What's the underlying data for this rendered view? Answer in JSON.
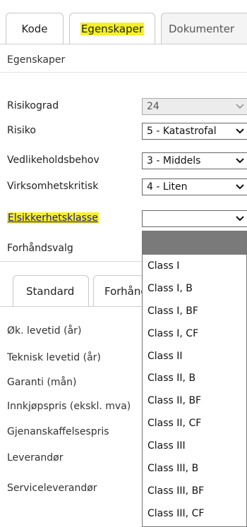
{
  "tabs": [
    {
      "label": "Kode"
    },
    {
      "label": "Egenskaper",
      "highlighted": true,
      "active": true
    },
    {
      "label": "Dokumenter"
    }
  ],
  "section_title": "Egenskaper",
  "fields": [
    {
      "label": "Risikograd",
      "value": "24",
      "disabled": true
    },
    {
      "label": "Risiko",
      "value": "5 - Katastrofal"
    },
    {
      "label": "Vedlikeholdsbehov",
      "value": "3 - Middels"
    },
    {
      "label": "Virksomhetskritisk",
      "value": "4 - Liten"
    },
    {
      "label": "Elsikkerhetsklasse",
      "value": "",
      "link": true,
      "highlighted": true
    }
  ],
  "preset_label": "Forhåndsvalg",
  "lower_tabs": [
    {
      "label": "Standard"
    },
    {
      "label": "Forhåndsvalg"
    }
  ],
  "lower_fields": [
    {
      "label": "Øk. levetid (år)"
    },
    {
      "label": "Teknisk levetid (år)"
    },
    {
      "label": "Garanti (mån)"
    },
    {
      "label": "Innkjøpspris (ekskl. mva)"
    },
    {
      "label": "Gjenanskaffelsespris"
    },
    {
      "label": "Leverandør"
    },
    {
      "label": "Serviceleverandør"
    }
  ],
  "dropdown_options": [
    "Class I",
    "Class I, B",
    "Class I, BF",
    "Class I, CF",
    "Class II",
    "Class II, B",
    "Class II, BF",
    "Class II, CF",
    "Class III",
    "Class III, B",
    "Class III, BF",
    "Class III, CF"
  ],
  "colors": {
    "highlight": "#f6f124",
    "link": "#1a0dab",
    "dropdown_header": "#7a7a7a"
  },
  "icons": {
    "select_arrow": "chevron-down-icon"
  }
}
